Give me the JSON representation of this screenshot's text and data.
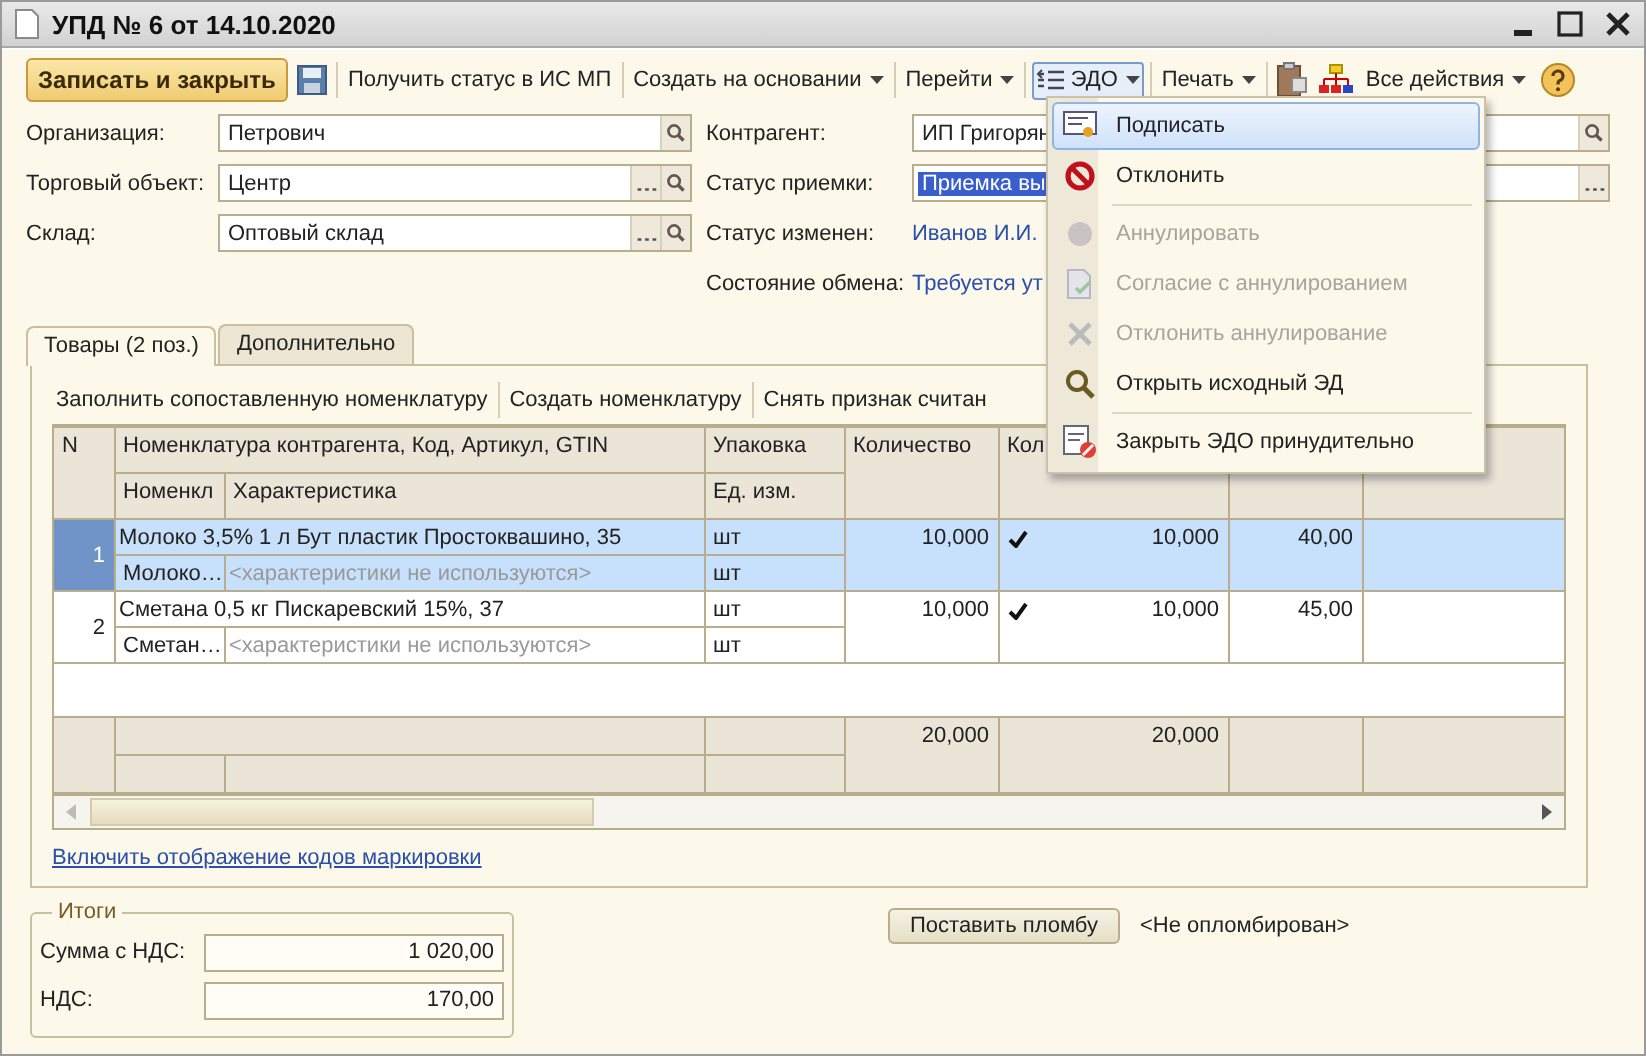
{
  "window": {
    "title": "УПД № 6 от 14.10.2020"
  },
  "toolbar": [
    {
      "kind": "primary",
      "label": "Записать и закрыть"
    },
    {
      "kind": "save"
    },
    {
      "kind": "plain",
      "label": "Получить статус в ИС МП"
    },
    {
      "kind": "menu",
      "label": "Создать на основании",
      "expanded": false
    },
    {
      "kind": "menu",
      "label": "Перейти",
      "expanded": false
    },
    {
      "kind": "edo",
      "label": "ЭДО",
      "expanded": true
    },
    {
      "kind": "menu",
      "label": "Печать",
      "expanded": false
    },
    {
      "kind": "clipboard"
    },
    {
      "kind": "structure"
    },
    {
      "kind": "menu",
      "label": "Все действия",
      "expanded": false
    },
    {
      "kind": "help"
    }
  ],
  "left_fields": [
    {
      "label": "Организация:",
      "value": "Петрович",
      "choice": false
    },
    {
      "label": "Торговый объект:",
      "value": "Центр",
      "choice": true
    },
    {
      "label": "Склад:",
      "value": "Оптовый склад",
      "choice": true
    }
  ],
  "right_fields": [
    {
      "kind": "field",
      "label": "Контрагент:",
      "value": "ИП Григорян",
      "lookup": true,
      "choice": false,
      "highlighted": false
    },
    {
      "kind": "field",
      "label": "Статус приемки:",
      "value": "Приемка вы",
      "lookup": false,
      "choice": true,
      "highlighted": true
    },
    {
      "kind": "link",
      "label": "Статус изменен:",
      "value": "Иванов И.И."
    },
    {
      "kind": "link",
      "label": "Состояние обмена:",
      "value": "Требуется ут"
    }
  ],
  "tabs": [
    {
      "label": "Товары (2 поз.)",
      "selected": true
    },
    {
      "label": "Дополнительно",
      "selected": false
    }
  ],
  "table_toolbar": [
    "Заполнить сопоставленную номенклатуру",
    "Создать номенклатуру",
    "Снять признак считан"
  ],
  "table": {
    "columns": {
      "n": "N",
      "name": "Номенклатура контрагента, Код, Артикул, GTIN",
      "pack": "Упаковка",
      "qty": "Количество",
      "column_5": "Кол",
      "short": "Номенкл",
      "char": "Характеристика",
      "unit": "Ед. изм."
    },
    "rows": [
      {
        "n": "1",
        "name": "Молоко 3,5% 1 л Бут пластик Простоквашино, 35",
        "pack": "шт",
        "qty": "10,000",
        "checked": true,
        "qty2": "10,000",
        "price": "40,00",
        "short": "Молоко…",
        "char": "<характеристики не используются>",
        "unit": "шт",
        "selected": true
      },
      {
        "n": "2",
        "name": "Сметана 0,5 кг  Пискаревский 15%, 37",
        "pack": "шт",
        "qty": "10,000",
        "checked": true,
        "qty2": "10,000",
        "price": "45,00",
        "short": "Сметан…",
        "char": "<характеристики не используются>",
        "unit": "шт",
        "selected": false
      }
    ],
    "totals": {
      "qty": "20,000",
      "qty2": "20,000"
    }
  },
  "marking_link": "Включить отображение кодов маркировки",
  "totals_group": {
    "title": "Итоги",
    "fields": [
      {
        "label": "Сумма с НДС:",
        "value": "1 020,00"
      },
      {
        "label": "НДС:",
        "value": "170,00"
      }
    ]
  },
  "seal_button": "Поставить пломбу",
  "seal_status": "<Не опломбирован>",
  "edo_menu": [
    [
      {
        "kind": "sign",
        "label": "Подписать",
        "disabled": false,
        "selected": true
      },
      {
        "kind": "reject",
        "label": "Отклонить",
        "disabled": false,
        "selected": false
      }
    ],
    [
      {
        "kind": "annul",
        "label": "Аннулировать",
        "disabled": true,
        "selected": false
      },
      {
        "kind": "agree",
        "label": "Согласие с аннулированием",
        "disabled": true,
        "selected": false
      },
      {
        "kind": "cross",
        "label": "Отклонить аннулирование",
        "disabled": true,
        "selected": false
      },
      {
        "kind": "search",
        "label": "Открыть исходный ЭД",
        "disabled": false,
        "selected": false
      }
    ],
    [
      {
        "kind": "close",
        "label": "Закрыть ЭДО принудительно",
        "disabled": false,
        "selected": false
      }
    ]
  ]
}
